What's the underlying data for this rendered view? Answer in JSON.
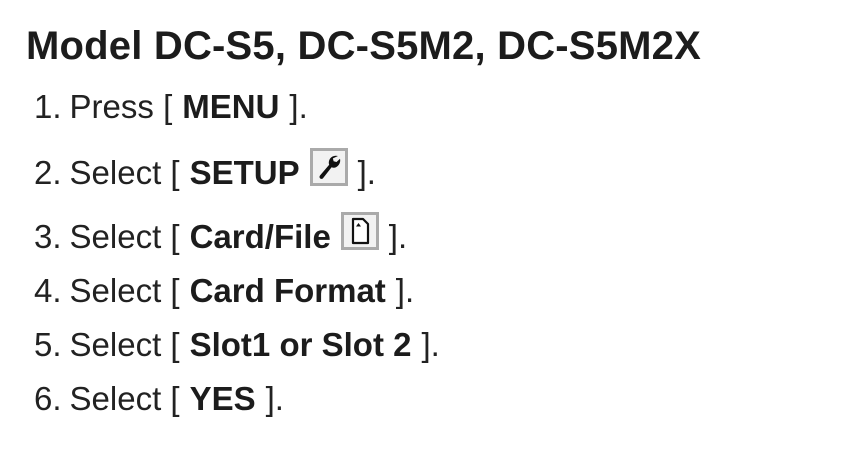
{
  "title": "Model DC-S5, DC-S5M2, DC-S5M2X",
  "steps": [
    {
      "number": "1.",
      "verb": "Press",
      "open": "[",
      "key": "MENU",
      "close": "].",
      "icon": null
    },
    {
      "number": "2.",
      "verb": "Select",
      "open": "[",
      "key": "SETUP",
      "close": "].",
      "icon": "wrench-icon"
    },
    {
      "number": "3.",
      "verb": "Select",
      "open": "[",
      "key": "Card/File",
      "close": "].",
      "icon": "memory-card-icon"
    },
    {
      "number": "4.",
      "verb": "Select",
      "open": "[",
      "key": "Card Format",
      "close": "].",
      "icon": null
    },
    {
      "number": "5.",
      "verb": "Select",
      "open": "[",
      "key": "Slot1 or Slot 2",
      "close": "].",
      "icon": null
    },
    {
      "number": "6.",
      "verb": "Select",
      "open": "[",
      "key": "YES",
      "close": "].",
      "icon": null
    }
  ]
}
